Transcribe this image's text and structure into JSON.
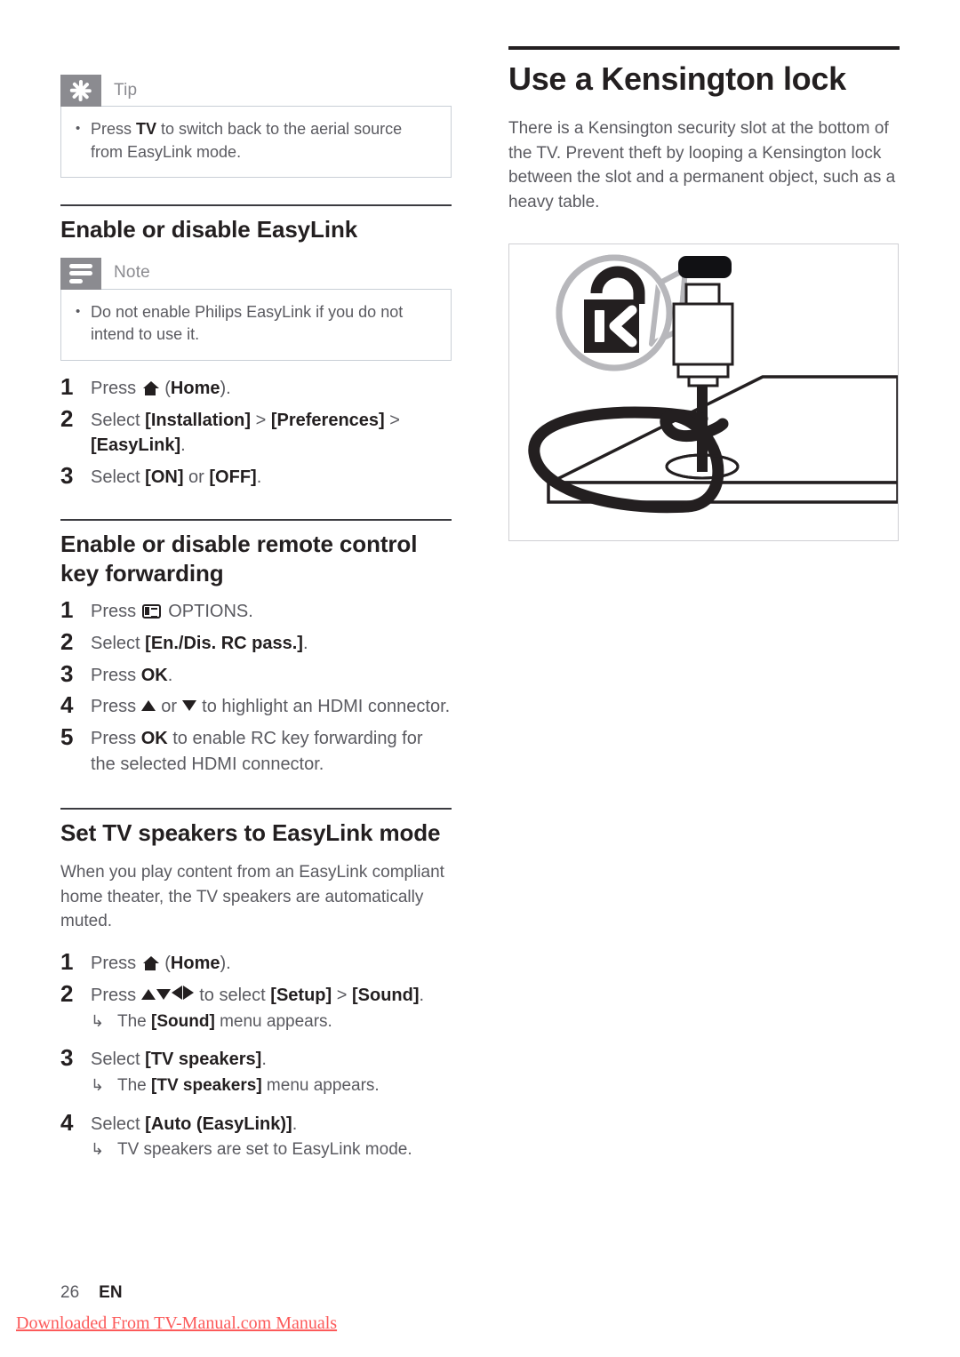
{
  "left_column": {
    "tip_callout": {
      "icon": "asterisk-icon",
      "title": "Tip",
      "bullet_prefix": "Press ",
      "bullet_bold": "TV",
      "bullet_suffix": " to switch back to the aerial source from EasyLink mode."
    },
    "section_easylink": {
      "heading": "Enable or disable EasyLink",
      "note_callout": {
        "icon": "lines-icon",
        "title": "Note",
        "bullet": "Do not enable Philips EasyLink if you do not intend to use it."
      },
      "steps": [
        {
          "num": "1",
          "pre": "Press ",
          "icon": "home-icon",
          "bold": "Home",
          "post": ""
        },
        {
          "num": "2",
          "text_parts": [
            "Select ",
            "[Installation]",
            " > ",
            "[Preferences]",
            " > ",
            "[EasyLink]",
            "."
          ]
        },
        {
          "num": "3",
          "text_parts": [
            "Select ",
            "[ON]",
            " or ",
            "[OFF]",
            "."
          ]
        }
      ]
    },
    "section_rc_forwarding": {
      "heading": "Enable or disable remote control key forwarding",
      "steps": [
        {
          "num": "1",
          "pre": "Press ",
          "icon": "options-icon",
          "post": " OPTIONS."
        },
        {
          "num": "2",
          "pre": "Select ",
          "bold": "[En./Dis. RC pass.]",
          "post": "."
        },
        {
          "num": "3",
          "pre": "Press ",
          "bold": "OK",
          "post": "."
        },
        {
          "num": "4",
          "pre": "Press ",
          "mid": " or ",
          "post": " to highlight an HDMI connector."
        },
        {
          "num": "5",
          "pre": "Press ",
          "bold": "OK",
          "post": " to enable RC key forwarding for the selected HDMI connector."
        }
      ]
    },
    "section_tv_speakers": {
      "heading": "Set TV speakers to EasyLink mode",
      "intro": "When you play content from an EasyLink compliant home theater, the TV speakers are automatically muted.",
      "steps": [
        {
          "num": "1",
          "pre": "Press ",
          "icon": "home-icon",
          "bold": "Home",
          "post": ""
        },
        {
          "num": "2",
          "pre": "Press ",
          "post": " to select ",
          "bold": "[Setup]",
          "sep": " > ",
          "bold2": "[Sound]",
          "end": ".",
          "sub": {
            "arrow": "↳",
            "pre": "The ",
            "bold": "[Sound]",
            "post": " menu appears."
          }
        },
        {
          "num": "3",
          "pre": "Select ",
          "bold": "[TV speakers]",
          "post": ".",
          "sub": {
            "arrow": "↳",
            "pre": "The ",
            "bold": "[TV speakers]",
            "post": " menu appears."
          }
        },
        {
          "num": "4",
          "pre": "Select ",
          "bold": "[Auto (EasyLink)]",
          "post": ".",
          "sub": {
            "arrow": "↳",
            "pre": "TV speakers are set to EasyLink mode.",
            "bold": "",
            "post": ""
          }
        }
      ]
    }
  },
  "right_column": {
    "title": "Use a Kensington lock",
    "paragraph": "There is a Kensington security slot at the bottom of the TV. Prevent theft by looping a Kensington lock between the slot and a permanent object, such as a heavy table.",
    "figure": {
      "name": "kensington-lock-diagram",
      "lock_logo_letter": "K"
    }
  },
  "footer": {
    "page_number": "26",
    "language": "EN",
    "watermark": "Downloaded From TV-Manual.com Manuals"
  },
  "colors": {
    "body_text": "#5a5a60",
    "heading_text": "#231f20",
    "callout_icon_bg": "#8b8b90",
    "callout_border": "#c9cfd6",
    "watermark": "#fc5a5a"
  }
}
